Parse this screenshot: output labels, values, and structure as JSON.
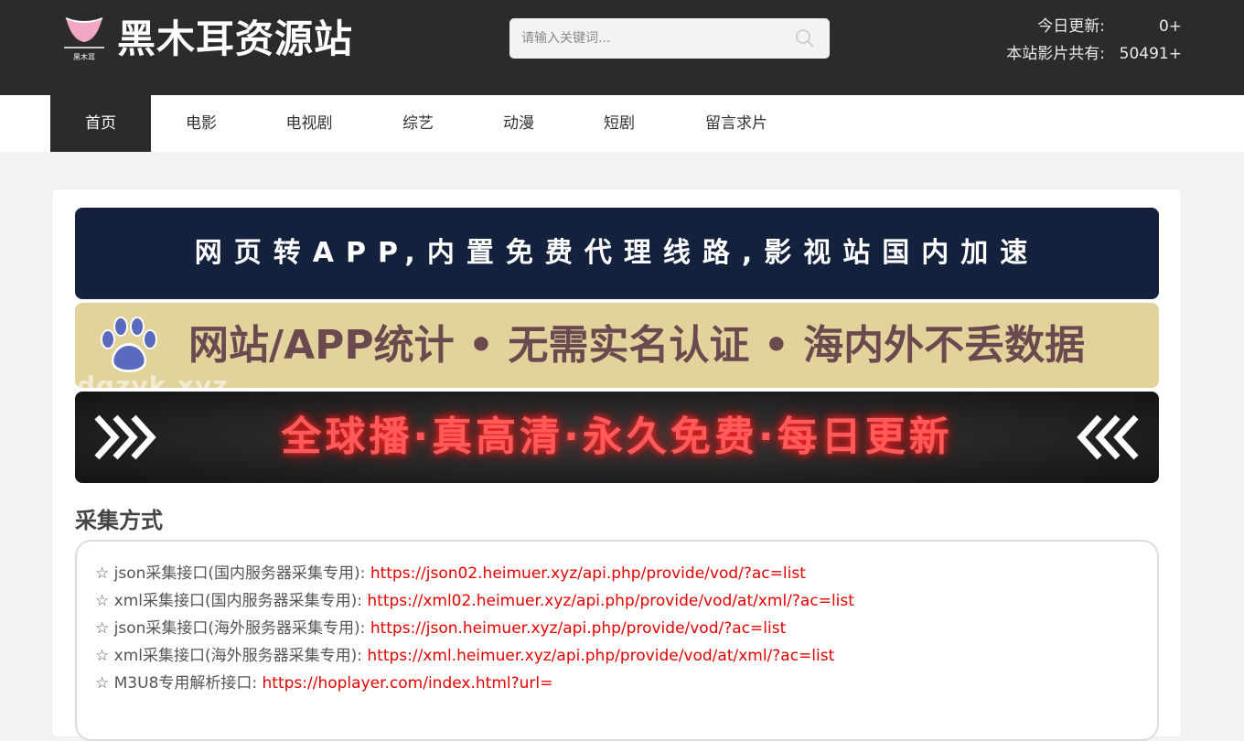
{
  "header": {
    "logo_caption": "黑木耳",
    "site_title": "黑木耳资源站",
    "search": {
      "placeholder": "请输入关键词..."
    },
    "stats": [
      {
        "label": "今日更新:",
        "value": "0+"
      },
      {
        "label": "本站影片共有:",
        "value": "50491+"
      }
    ]
  },
  "nav": {
    "items": [
      {
        "label": "首页",
        "active": true
      },
      {
        "label": "电影"
      },
      {
        "label": "电视剧"
      },
      {
        "label": "综艺"
      },
      {
        "label": "动漫"
      },
      {
        "label": "短剧"
      },
      {
        "label": "留言求片"
      }
    ]
  },
  "banners": [
    {
      "text": "网页转APP,内置免费代理线路,影视站国内加速"
    },
    {
      "text": "网站/APP统计 • 无需实名认证 • 海内外不丢数据",
      "watermark": "dgzyk.xyz",
      "icon": "paw-icon"
    },
    {
      "text": "全球播·真高清·永久免费·每日更新",
      "icons": [
        "chevrons-right-icon",
        "chevrons-left-icon"
      ]
    }
  ],
  "collection": {
    "title": "采集方式",
    "items": [
      {
        "label": "☆ json采集接口(国内服务器采集专用):",
        "url": "https://json02.heimuer.xyz/api.php/provide/vod/?ac=list"
      },
      {
        "label": "☆ xml采集接口(国内服务器采集专用):",
        "url": "https://xml02.heimuer.xyz/api.php/provide/vod/at/xml/?ac=list"
      },
      {
        "label": "☆ json采集接口(海外服务器采集专用):",
        "url": "https://json.heimuer.xyz/api.php/provide/vod/?ac=list"
      },
      {
        "label": "☆ xml采集接口(海外服务器采集专用):",
        "url": "https://xml.heimuer.xyz/api.php/provide/vod/at/xml/?ac=list"
      },
      {
        "label": "☆ M3U8专用解析接口:",
        "url": "https://hoplayer.com/index.html?url="
      }
    ]
  },
  "colors": {
    "header_bg": "#2b2b2b",
    "link_red": "#e60000",
    "banner1_bg": "#14213d",
    "banner2_bg": "#e2d29c"
  }
}
